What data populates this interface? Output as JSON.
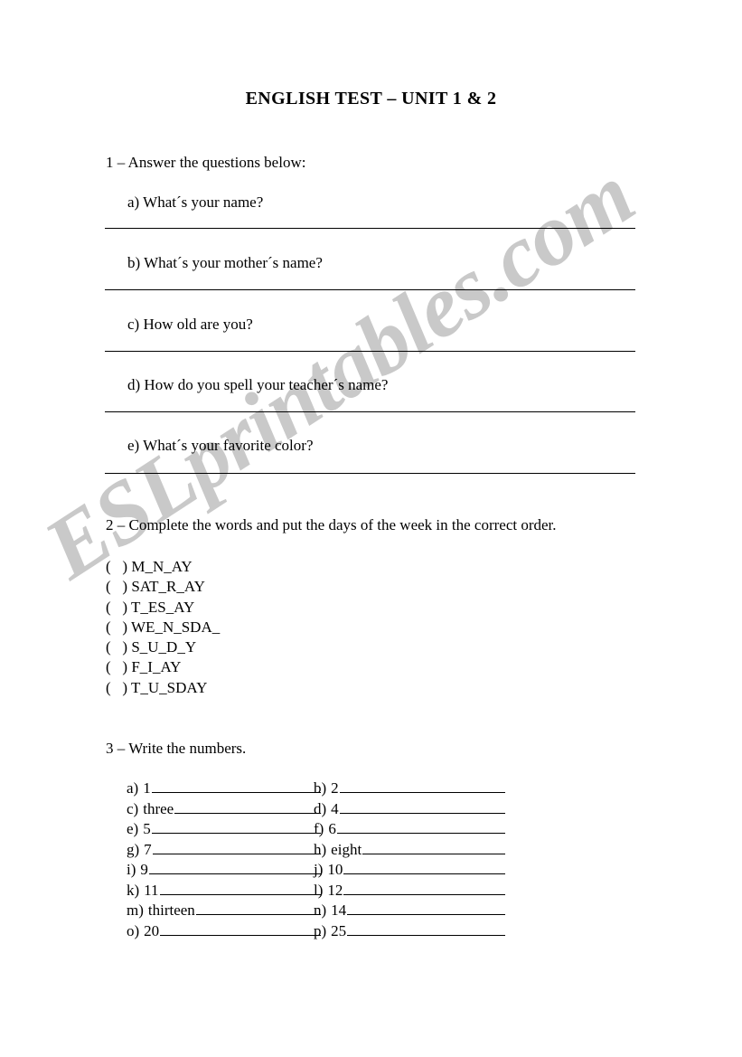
{
  "document": {
    "title": "ENGLISH  TEST – UNIT 1 & 2",
    "watermark": "ESLprintables.com"
  },
  "section1": {
    "heading": "1 – Answer the questions below:",
    "questions": [
      {
        "label": "a)",
        "text": "a)  What´s your name?"
      },
      {
        "label": "b)",
        "text": "b)  What´s your mother´s name?"
      },
      {
        "label": "c)",
        "text": "c)  How old are you?"
      },
      {
        "label": "d)",
        "text": "d)  How do you spell your teacher´s name?"
      },
      {
        "label": "e)",
        "text": "e)  What´s your favorite color?"
      }
    ]
  },
  "section2": {
    "heading": "2 – Complete the words and put the days of the week in the correct order.",
    "items": [
      "(   ) M_N_AY",
      "(   ) SAT_R_AY",
      "(   ) T_ES_AY",
      "(   ) WE_N_SDA_",
      "(   ) S_U_D_Y",
      "(   ) F_I_AY",
      "(   ) T_U_SDAY"
    ]
  },
  "section3": {
    "heading": "3 – Write the numbers.",
    "rows": [
      {
        "left": {
          "label": "a)",
          "value": "1"
        },
        "right": {
          "label": "b)",
          "value": "2"
        }
      },
      {
        "left": {
          "label": "c)",
          "value": "three"
        },
        "right": {
          "label": "d)",
          "value": "4"
        }
      },
      {
        "left": {
          "label": "e)",
          "value": "5"
        },
        "right": {
          "label": "f)",
          "value": "6"
        }
      },
      {
        "left": {
          "label": "g)",
          "value": "7"
        },
        "right": {
          "label": "h)",
          "value": "eight"
        }
      },
      {
        "left": {
          "label": "i)",
          "value": "9"
        },
        "right": {
          "label": "j)",
          "value": "10"
        }
      },
      {
        "left": {
          "label": "k)",
          "value": "11"
        },
        "right": {
          "label": "l)",
          "value": "12"
        }
      },
      {
        "left": {
          "label": "m)",
          "value": "thirteen"
        },
        "right": {
          "label": "n)",
          "value": "14"
        }
      },
      {
        "left": {
          "label": "o)",
          "value": "20"
        },
        "right": {
          "label": "p)",
          "value": "25"
        }
      }
    ]
  }
}
